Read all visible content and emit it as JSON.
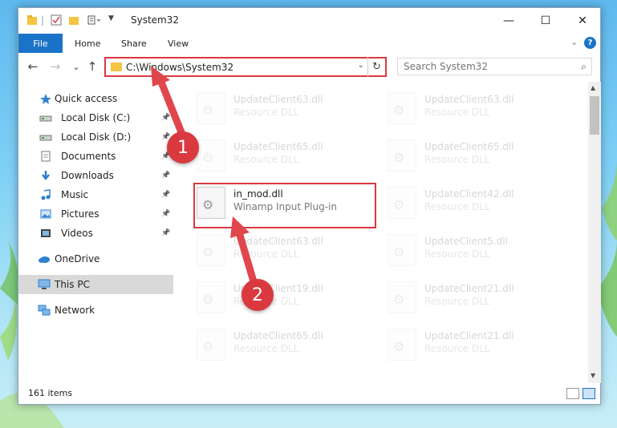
{
  "window": {
    "title": "System32",
    "minimize_glyph": "—",
    "maximize_glyph": "☐",
    "close_glyph": "✕"
  },
  "ribbon": {
    "file_label": "File",
    "home_label": "Home",
    "share_label": "Share",
    "view_label": "View"
  },
  "nav": {
    "back_glyph": "←",
    "forward_glyph": "→",
    "recent_glyph": "⌄",
    "up_glyph": "↑",
    "address": "C:\\Windows\\System32",
    "refresh_glyph": "↻",
    "search_placeholder": "Search System32"
  },
  "sidebar": {
    "items": [
      {
        "label": "Quick access",
        "icon": "star-icon",
        "pinned": false
      },
      {
        "label": "Local Disk (C:)",
        "icon": "drive-icon",
        "pinned": true
      },
      {
        "label": "Local Disk (D:)",
        "icon": "drive-icon",
        "pinned": true
      },
      {
        "label": "Documents",
        "icon": "documents-icon",
        "pinned": true
      },
      {
        "label": "Downloads",
        "icon": "download-icon",
        "pinned": true
      },
      {
        "label": "Music",
        "icon": "music-icon",
        "pinned": true
      },
      {
        "label": "Pictures",
        "icon": "pictures-icon",
        "pinned": true
      },
      {
        "label": "Videos",
        "icon": "videos-icon",
        "pinned": true
      },
      {
        "label": "OneDrive",
        "icon": "cloud-icon",
        "pinned": false
      },
      {
        "label": "This PC",
        "icon": "computer-icon",
        "pinned": false,
        "selected": true
      },
      {
        "label": "Network",
        "icon": "network-icon",
        "pinned": false
      }
    ]
  },
  "files": [
    {
      "name": "UpdateClient63.dll",
      "desc": "Resource DLL"
    },
    {
      "name": "UpdateClient63.dll",
      "desc": "Resource DLL"
    },
    {
      "name": "UpdateClient65.dll",
      "desc": "Resource DLL"
    },
    {
      "name": "UpdateClient65.dll",
      "desc": "Resource DLL"
    },
    {
      "name": "in_mod.dll",
      "desc": "Winamp Input Plug-in",
      "highlighted": true
    },
    {
      "name": "UpdateClient42.dll",
      "desc": "Resource DLL"
    },
    {
      "name": "UpdateClient63.dll",
      "desc": "Resource DLL"
    },
    {
      "name": "UpdateClient5.dll",
      "desc": "Resource DLL"
    },
    {
      "name": "UpdateClient19.dll",
      "desc": "Resource DLL"
    },
    {
      "name": "UpdateClient21.dll",
      "desc": "Resource DLL"
    },
    {
      "name": "UpdateClient65.dll",
      "desc": "Resource DLL"
    },
    {
      "name": "UpdateClient21.dll",
      "desc": "Resource DLL"
    }
  ],
  "status": {
    "item_count": "161 items"
  },
  "annotations": {
    "step1": "1",
    "step2": "2"
  },
  "colors": {
    "accent": "#1a73c8",
    "highlight": "#d9393f",
    "selected_bg": "#d9d9d9"
  }
}
